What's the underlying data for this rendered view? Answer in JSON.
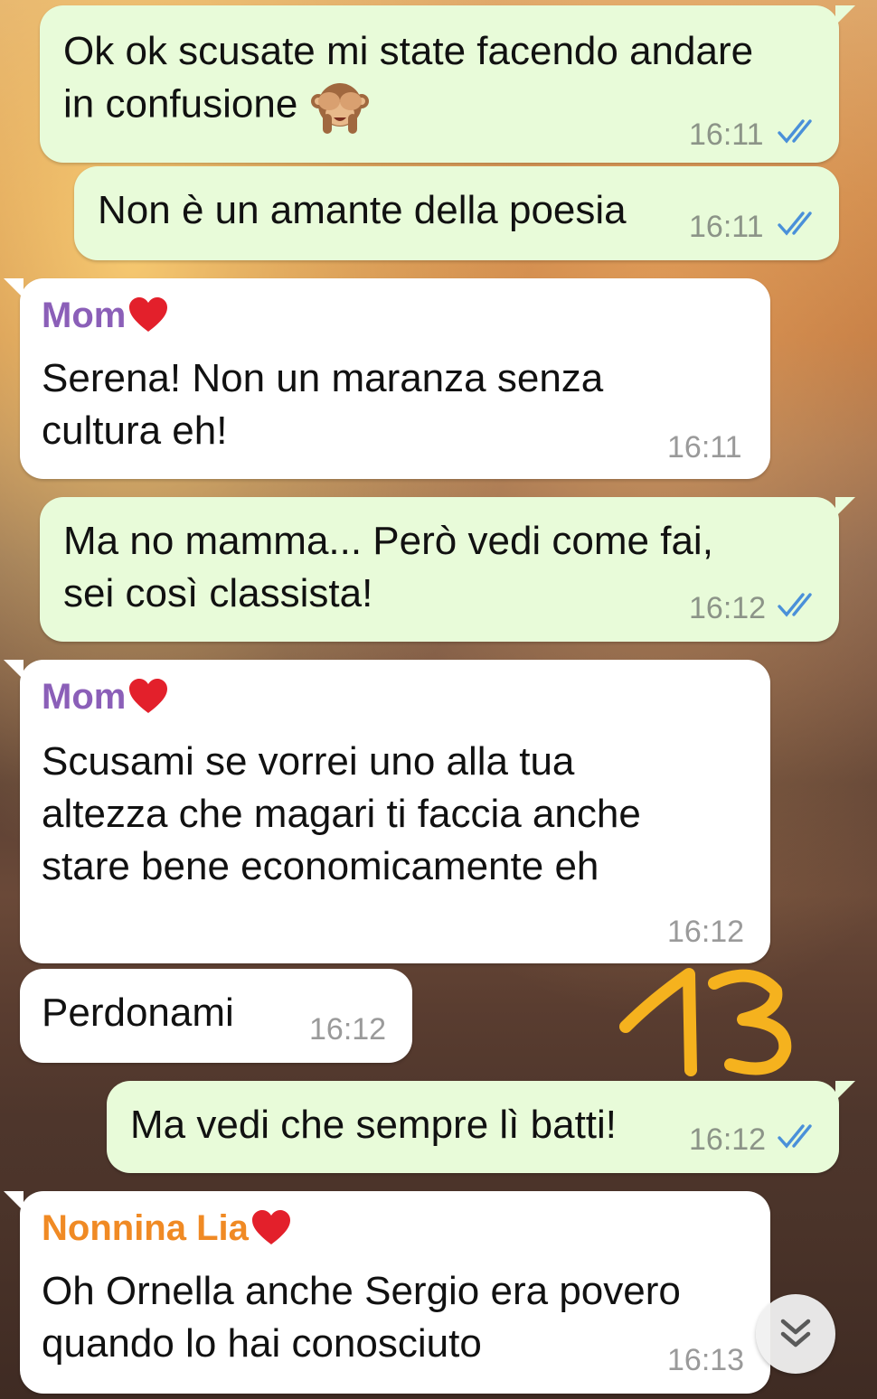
{
  "messages": [
    {
      "direction": "outgoing",
      "text": "Ok ok scusate mi state facendo andare\nin confusione",
      "emoji": "see-no-evil-monkey-icon",
      "time": "16:11",
      "status": "read"
    },
    {
      "direction": "outgoing",
      "text": "Non è un amante della poesia",
      "time": "16:11",
      "status": "read"
    },
    {
      "direction": "incoming",
      "sender": "Mom",
      "sender_color": "#8b5fb8",
      "text": "Serena! Non un maranza senza\ncultura eh!",
      "time": "16:11"
    },
    {
      "direction": "outgoing",
      "text": "Ma no mamma... Però vedi come fai,\nsei così classista!",
      "time": "16:12",
      "status": "read"
    },
    {
      "direction": "incoming",
      "sender": "Mom",
      "sender_color": "#8b5fb8",
      "text": "Scusami se vorrei uno alla tua\naltezza che magari ti faccia anche\nstare bene economicamente eh",
      "time": "16:12"
    },
    {
      "direction": "incoming",
      "text": "Perdonami",
      "time": "16:12"
    },
    {
      "direction": "outgoing",
      "text": "Ma vedi che sempre lì batti!",
      "time": "16:12",
      "status": "read"
    },
    {
      "direction": "incoming",
      "sender": "Nonnina Lia",
      "sender_color": "#f08a24",
      "text": "Oh Ornella anche Sergio era povero\nquando lo hai conosciuto",
      "time": "16:13"
    }
  ],
  "annotation": {
    "text": "13",
    "color": "#f5b21e"
  },
  "colors": {
    "outgoing_bubble": "#e8fbd9",
    "incoming_bubble": "#ffffff",
    "read_ticks": "#4a90d9"
  },
  "scroll_button": {
    "icon": "double-chevron-down-icon"
  }
}
